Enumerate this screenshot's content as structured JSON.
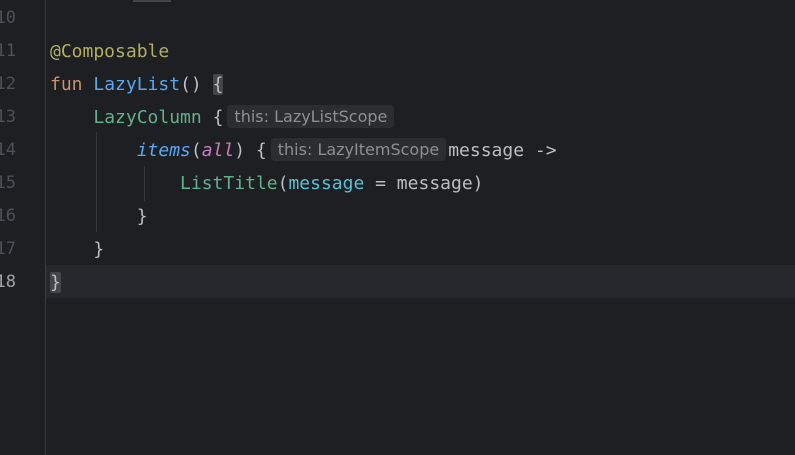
{
  "editor": {
    "line_numbers": [
      "10",
      "11",
      "12",
      "13",
      "14",
      "15",
      "16",
      "17",
      "18"
    ],
    "active_line": "18",
    "lines": {
      "l11_annotation": "@Composable",
      "l12_keyword": "fun",
      "l12_name": "LazyList",
      "l12_rest": "() ",
      "l12_brace": "{",
      "l13_call": "LazyColumn",
      "l13_brace": " {",
      "l13_hint": "this: LazyListScope",
      "l14_call": "items",
      "l14_open": "(",
      "l14_arg": "all",
      "l14_close": ") {",
      "l14_hint": "this: LazyItemScope",
      "l14_rest": "message ->",
      "l15_call": "ListTitle",
      "l15_open": "(",
      "l15_named": "message",
      "l15_rest": " = message)",
      "l16_brace": "}",
      "l17_brace": "}",
      "l18_brace": "}"
    }
  },
  "colors": {
    "background": "#1e1f22",
    "annotation": "#b3ae60",
    "keyword": "#cf8e6d",
    "function": "#56a8f5",
    "composable": "#5fb389",
    "parameter": "#c77dbb",
    "named_argument": "#56c1d6",
    "hint_background": "#2b2d30"
  }
}
